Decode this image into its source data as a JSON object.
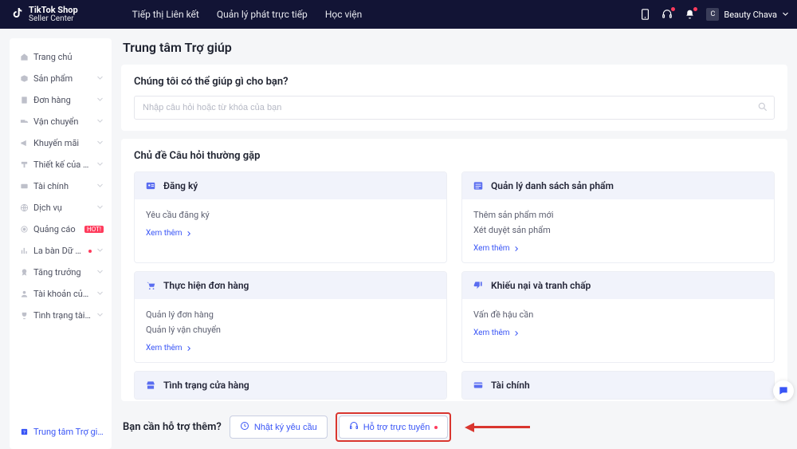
{
  "header": {
    "logo_line1": "TikTok Shop",
    "logo_line2": "Seller Center",
    "nav": [
      "Tiếp thị Liên kết",
      "Quản lý phát trực tiếp",
      "Học viện"
    ],
    "account_name": "Beauty Chava"
  },
  "sidebar": {
    "items": [
      {
        "icon": "home",
        "label": "Trang chủ",
        "expandable": false
      },
      {
        "icon": "box",
        "label": "Sản phẩm",
        "expandable": true
      },
      {
        "icon": "receipt",
        "label": "Đơn hàng",
        "expandable": true
      },
      {
        "icon": "truck",
        "label": "Vận chuyển",
        "expandable": true
      },
      {
        "icon": "megaphone",
        "label": "Khuyến mãi",
        "expandable": true
      },
      {
        "icon": "paint",
        "label": "Thiết kế của hàng",
        "expandable": true
      },
      {
        "icon": "wallet",
        "label": "Tài chính",
        "expandable": true
      },
      {
        "icon": "globe",
        "label": "Dịch vụ",
        "expandable": true
      },
      {
        "icon": "target",
        "label": "Quảng cáo",
        "expandable": false,
        "badge": "HOT!"
      },
      {
        "icon": "chart",
        "label": "La bàn Dữ liệu",
        "expandable": true,
        "dot": true
      },
      {
        "icon": "medal",
        "label": "Tăng trưởng",
        "expandable": true
      },
      {
        "icon": "user",
        "label": "Tài khoản của tôi",
        "expandable": true
      },
      {
        "icon": "trophy",
        "label": "Tình trạng tài k…",
        "expandable": true
      }
    ],
    "help_label": "Trung tâm Trợ giúp"
  },
  "main": {
    "title": "Trung tâm Trợ giúp",
    "search_heading": "Chúng tôi có thể giúp gì cho bạn?",
    "search_placeholder": "Nhập câu hỏi hoặc từ khóa của bạn",
    "faq_heading": "Chủ đề Câu hỏi thường gặp",
    "see_more": "Xem thêm",
    "faq_cards": [
      {
        "icon": "person-card",
        "title": "Đăng ký",
        "lines": [
          "Yêu cầu đăng ký"
        ]
      },
      {
        "icon": "list",
        "title": "Quản lý danh sách sản phẩm",
        "lines": [
          "Thêm sản phẩm mới",
          "Xét duyệt sản phẩm"
        ]
      },
      {
        "icon": "cart",
        "title": "Thực hiện đơn hàng",
        "lines": [
          "Quản lý đơn hàng",
          "Quản lý vận chuyển"
        ]
      },
      {
        "icon": "thumbs-down",
        "title": "Khiếu nại và tranh chấp",
        "lines": [
          "Vấn đề hậu cần"
        ]
      },
      {
        "icon": "store",
        "title": "Tình trạng cửa hàng",
        "lines": []
      },
      {
        "icon": "card",
        "title": "Tài chính",
        "lines": []
      }
    ],
    "support_prompt": "Bạn cần hỗ trợ thêm?",
    "support_buttons": [
      {
        "icon": "clock",
        "label": "Nhật ký yêu cầu"
      },
      {
        "icon": "headset",
        "label": "Hỗ trợ trực tuyến",
        "dot": true,
        "highlight": true
      }
    ]
  },
  "colors": {
    "accent": "#3955f6",
    "danger": "#d9362f",
    "headerbg": "#121435"
  }
}
